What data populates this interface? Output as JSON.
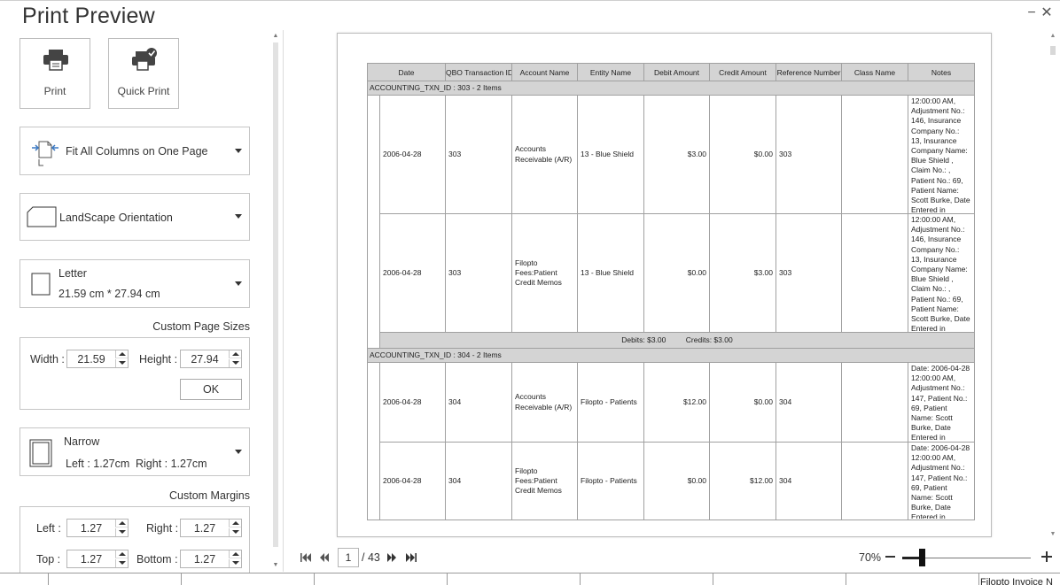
{
  "window": {
    "title": "Print Preview",
    "minimize": "−",
    "close": "✕"
  },
  "print": {
    "print_label": "Print",
    "quick_print_label": "Quick Print"
  },
  "scaling": {
    "selected": "Fit All Columns on One Page"
  },
  "orientation": {
    "selected": "LandScape Orientation"
  },
  "paper": {
    "name": "Letter",
    "size": "21.59 cm * 27.94 cm"
  },
  "custom_page": {
    "title": "Custom Page Sizes",
    "width_label": "Width :",
    "width_value": "21.59",
    "height_label": "Height :",
    "height_value": "27.94",
    "ok_label": "OK"
  },
  "margins": {
    "name": "Narrow",
    "left_text": "Left : 1.27cm",
    "right_text": "Right : 1.27cm"
  },
  "custom_margins": {
    "title": "Custom Margins",
    "left_label": "Left :",
    "left_value": "1.27",
    "right_label": "Right :",
    "right_value": "1.27",
    "top_label": "Top :",
    "top_value": "1.27",
    "bottom_label": "Bottom :",
    "bottom_value": "1.27"
  },
  "report": {
    "columns": [
      "Date",
      "QBO Transaction ID",
      "Account Name",
      "Entity Name",
      "Debit Amount",
      "Credit Amount",
      "Reference Number",
      "Class Name",
      "Notes"
    ],
    "groups": [
      {
        "label": "ACCOUNTING_TXN_ID : 303 - 2 Items",
        "rows": [
          {
            "date": "2006-04-28",
            "txn": "303",
            "account": "Accounts Receivable (A/R)",
            "entity": "13 - Blue Shield",
            "debit": "$3.00",
            "credit": "$0.00",
            "ref": "303",
            "class": "",
            "notes": "12:00:00 AM, Adjustment No.: 146, Insurance Company No.: 13, Insurance Company Name: Blue Shield , Claim No.: , Patient No.: 69, Patient Name: Scott Burke, Date Entered in"
          },
          {
            "date": "2006-04-28",
            "txn": "303",
            "account": "Filopto Fees:Patient Credit Memos",
            "entity": "13 - Blue Shield",
            "debit": "$0.00",
            "credit": "$3.00",
            "ref": "303",
            "class": "",
            "notes": "12:00:00 AM, Adjustment No.: 146, Insurance Company No.: 13, Insurance Company Name: Blue Shield , Claim No.: , Patient No.: 69, Patient Name: Scott Burke, Date Entered in"
          }
        ],
        "summary": {
          "debits": "Debits: $3.00",
          "credits": "Credits: $3.00"
        }
      },
      {
        "label": "ACCOUNTING_TXN_ID : 304 - 2 Items",
        "rows": [
          {
            "date": "2006-04-28",
            "txn": "304",
            "account": "Accounts Receivable (A/R)",
            "entity": "Filopto - Patients",
            "debit": "$12.00",
            "credit": "$0.00",
            "ref": "304",
            "class": "",
            "notes": "Date: 2006-04-28 12:00:00 AM, Adjustment No.: 147, Patient No.: 69, Patient Name: Scott Burke, Date Entered in Filopto:"
          },
          {
            "date": "2006-04-28",
            "txn": "304",
            "account": "Filopto Fees:Patient Credit Memos",
            "entity": "Filopto - Patients",
            "debit": "$0.00",
            "credit": "$12.00",
            "ref": "304",
            "class": "",
            "notes": "Date: 2006-04-28 12:00:00 AM, Adjustment No.: 147, Patient No.: 69, Patient Name: Scott Burke, Date Entered in Filopto:"
          }
        ]
      }
    ]
  },
  "navigation": {
    "current_page": "1",
    "page_count": "/ 43",
    "zoom": "70%",
    "zoom_fraction": 0.15
  },
  "bottom_strip": {
    "text": "Filopto Invoice N"
  }
}
